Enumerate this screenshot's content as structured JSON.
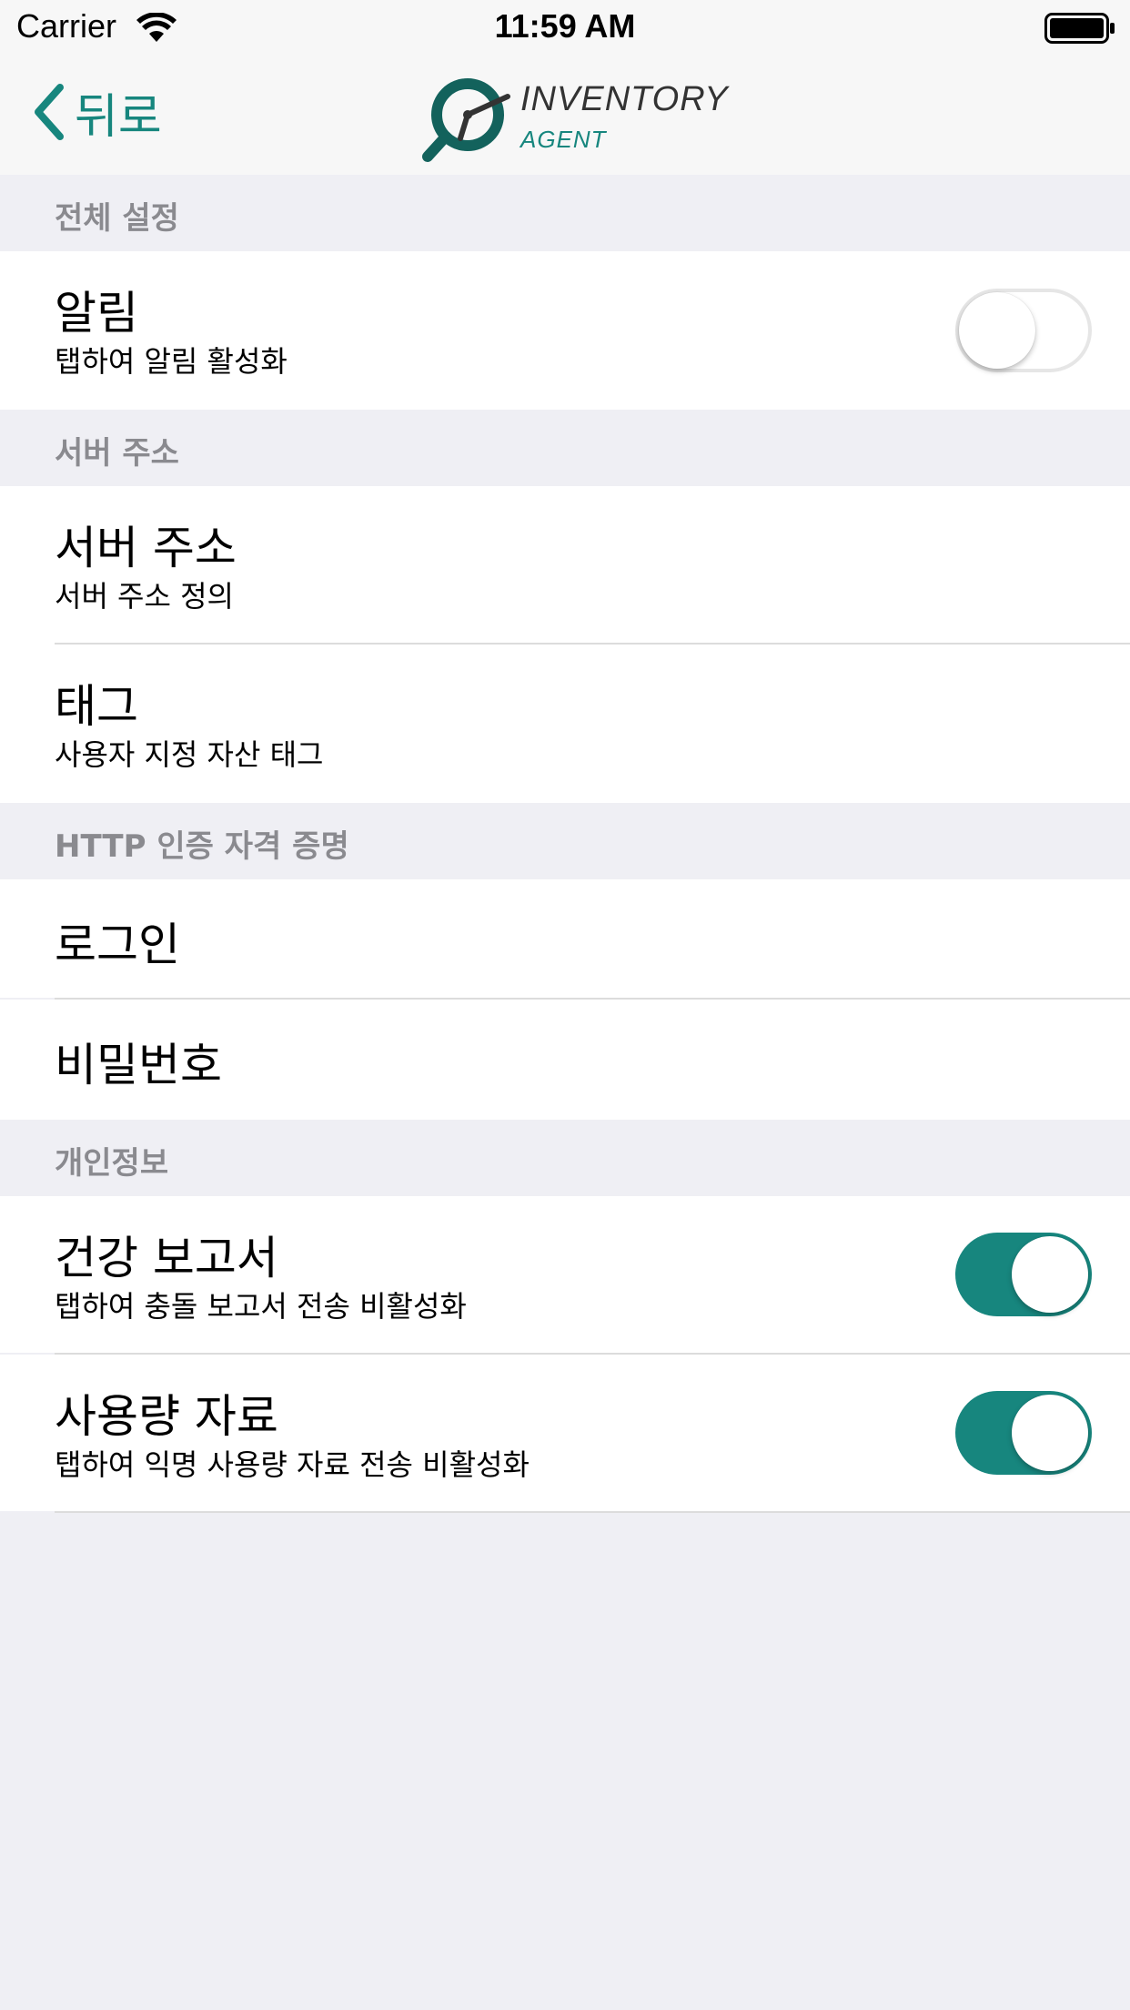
{
  "status_bar": {
    "carrier": "Carrier",
    "time": "11:59 AM"
  },
  "nav": {
    "back_label": "뒤로",
    "logo_title": "INVENTORY",
    "logo_subtitle": "AGENT"
  },
  "colors": {
    "accent": "#17867e",
    "background": "#efeff4",
    "section_text": "#8a8a8f"
  },
  "sections": {
    "general": {
      "header": "전체 설정",
      "notifications": {
        "title": "알림",
        "subtitle": "탭하여 알림 활성화",
        "enabled": false
      }
    },
    "server": {
      "header": "서버 주소",
      "server_address": {
        "title": "서버 주소",
        "subtitle": "서버 주소 정의"
      },
      "tag": {
        "title": "태그",
        "subtitle": "사용자 지정 자산 태그"
      }
    },
    "http_auth": {
      "header": "HTTP 인증 자격 증명",
      "login": {
        "title": "로그인"
      },
      "password": {
        "title": "비밀번호"
      }
    },
    "privacy": {
      "header": "개인정보",
      "health_report": {
        "title": "건강 보고서",
        "subtitle": "탭하여 충돌 보고서 전송 비활성화",
        "enabled": true
      },
      "usage_data": {
        "title": "사용량 자료",
        "subtitle": "탭하여 익명 사용량 자료 전송 비활성화",
        "enabled": true
      }
    }
  }
}
